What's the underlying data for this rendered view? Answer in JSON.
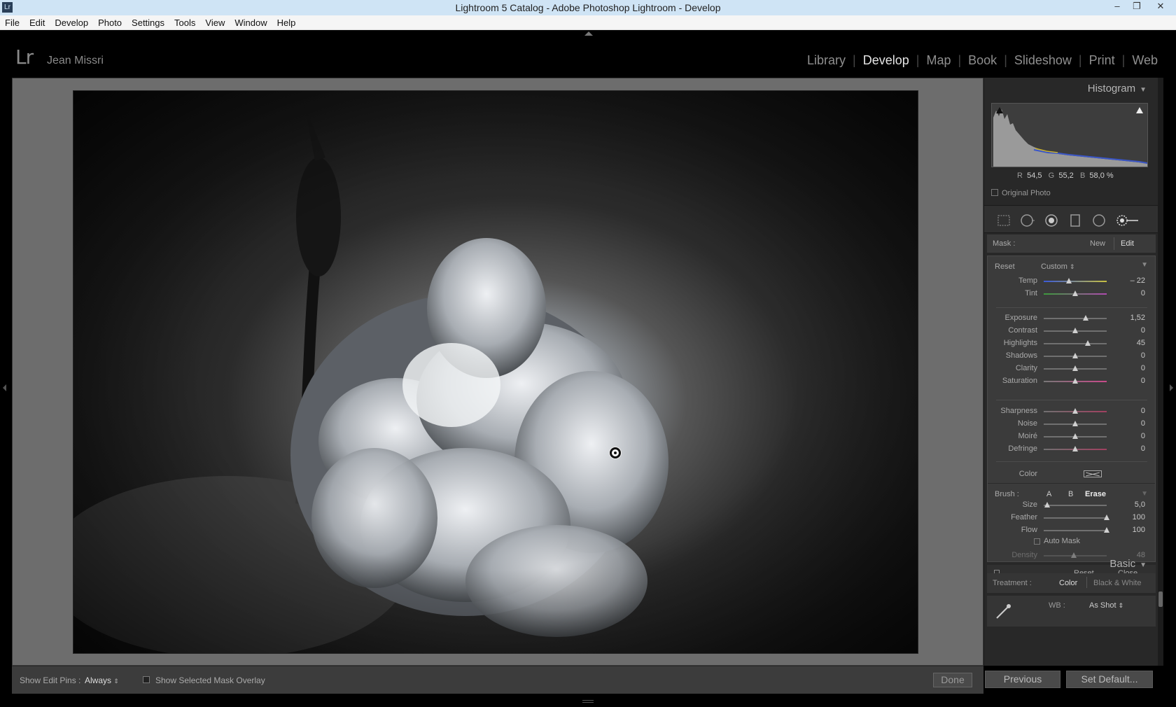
{
  "window": {
    "app_icon": "Lr",
    "title": "Lightroom 5 Catalog - Adobe Photoshop Lightroom - Develop"
  },
  "menu": [
    "File",
    "Edit",
    "Develop",
    "Photo",
    "Settings",
    "Tools",
    "View",
    "Window",
    "Help"
  ],
  "identity": {
    "logo": "Lr",
    "name": "Jean Missri"
  },
  "modules": [
    "Library",
    "Develop",
    "Map",
    "Book",
    "Slideshow",
    "Print",
    "Web"
  ],
  "active_module": "Develop",
  "histogram": {
    "header": "Histogram",
    "r_label": "R",
    "r_value": "54,5",
    "g_label": "G",
    "g_value": "55,2",
    "b_label": "B",
    "b_value": "58,0 %",
    "original_photo": "Original Photo"
  },
  "tools": [
    "crop-overlay-icon",
    "spot-removal-icon",
    "red-eye-correction-icon",
    "graduated-filter-icon",
    "radial-filter-icon",
    "adjustment-brush-icon"
  ],
  "mask": {
    "label": "Mask :",
    "new": "New",
    "edit": "Edit"
  },
  "adjustments": {
    "reset": "Reset",
    "preset": "Custom",
    "sliders_wb": [
      {
        "label": "Temp",
        "value": "– 22",
        "pos": 0.4
      },
      {
        "label": "Tint",
        "value": "0",
        "pos": 0.5
      }
    ],
    "sliders_tone": [
      {
        "label": "Exposure",
        "value": "1,52",
        "pos": 0.67
      },
      {
        "label": "Contrast",
        "value": "0",
        "pos": 0.5
      },
      {
        "label": "Highlights",
        "value": "45",
        "pos": 0.7
      },
      {
        "label": "Shadows",
        "value": "0",
        "pos": 0.5
      },
      {
        "label": "Clarity",
        "value": "0",
        "pos": 0.5
      },
      {
        "label": "Saturation",
        "value": "0",
        "pos": 0.5
      }
    ],
    "sliders_detail": [
      {
        "label": "Sharpness",
        "value": "0",
        "pos": 0.5
      },
      {
        "label": "Noise",
        "value": "0",
        "pos": 0.5
      },
      {
        "label": "Moiré",
        "value": "0",
        "pos": 0.5
      },
      {
        "label": "Defringe",
        "value": "0",
        "pos": 0.5
      }
    ],
    "color_label": "Color"
  },
  "brush": {
    "label": "Brush :",
    "a": "A",
    "b": "B",
    "erase": "Erase",
    "sliders": [
      {
        "label": "Size",
        "value": "5,0",
        "pos": 0.05
      },
      {
        "label": "Feather",
        "value": "100",
        "pos": 1.0
      },
      {
        "label": "Flow",
        "value": "100",
        "pos": 1.0
      }
    ],
    "auto_mask": "Auto Mask",
    "density": {
      "label": "Density",
      "value": "48",
      "pos": 0.48
    },
    "reset": "Reset",
    "close": "Close"
  },
  "basic": {
    "header": "Basic",
    "treatment_label": "Treatment :",
    "color": "Color",
    "bw": "Black & White",
    "wb_label": "WB :",
    "wb_value": "As Shot"
  },
  "toolbar": {
    "show_edit_pins_label": "Show Edit Pins :",
    "show_edit_pins_value": "Always",
    "overlay_label": "Show Selected Mask Overlay",
    "done": "Done"
  },
  "buttons": {
    "previous": "Previous",
    "set_default": "Set Default..."
  },
  "colors": {
    "panel_bg": "#282828",
    "work_bg": "#6d6d6d",
    "titlebar": "#cfe4f5"
  }
}
